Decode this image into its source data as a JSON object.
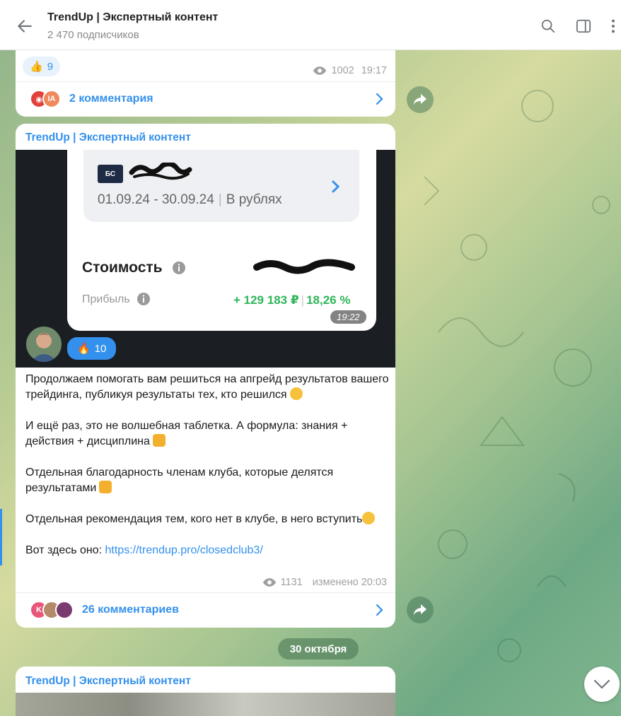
{
  "header": {
    "title": "TrendUp | Экспертный контент",
    "subscribers": "2 470 подписчиков"
  },
  "post1": {
    "reaction": {
      "emoji": "👍",
      "count": "9"
    },
    "views": "1002",
    "time": "19:17",
    "comments": {
      "label": "2 комментария",
      "avatars": [
        {
          "initials": "",
          "color": "#e0413a"
        },
        {
          "initials": "IA",
          "color": "#f08a5d"
        }
      ]
    }
  },
  "post2": {
    "sender": "TrendUp | Экспертный контент",
    "screenshot": {
      "badge": "БС",
      "date_from_to": "01.09.24 - 30.09.24",
      "currency": "В рублях",
      "cost_label": "Стоимость",
      "profit_label": "Прибыль",
      "profit_rub": "+ 129 183 ₽",
      "profit_pct": "18,26 %",
      "time": "19:22"
    },
    "reaction": {
      "emoji": "🔥",
      "count": "10"
    },
    "text": {
      "p1": "Продолжаем помогать вам решиться на апгрейд результатов вашего трейдинга, публикуя результаты тех, кто решился",
      "p2": "И ещё раз, это не волшебная таблетка. А формула: знания + действия + дисциплина",
      "p3": "Отдельная благодарность членам клуба, которые делятся результатами",
      "p4": "Отдельная рекомендация тем, кого нет в клубе, в него вступить",
      "p5_prefix": "Вот здесь оно: ",
      "link": "https://trendup.pro/closedclub3/"
    },
    "views": "1131",
    "edited": "изменено 20:03",
    "comments": {
      "label": "26 комментариев",
      "avatars": [
        {
          "initials": "K",
          "color": "#e8577a"
        },
        {
          "initials": "",
          "color": "#b58a6a"
        },
        {
          "initials": "",
          "color": "#7a3b6e"
        }
      ]
    }
  },
  "date_separator": "30 октября",
  "post3": {
    "sender": "TrendUp | Экспертный контент"
  },
  "colors": {
    "accent": "#3390ec",
    "profit_green": "#2fb55a"
  }
}
